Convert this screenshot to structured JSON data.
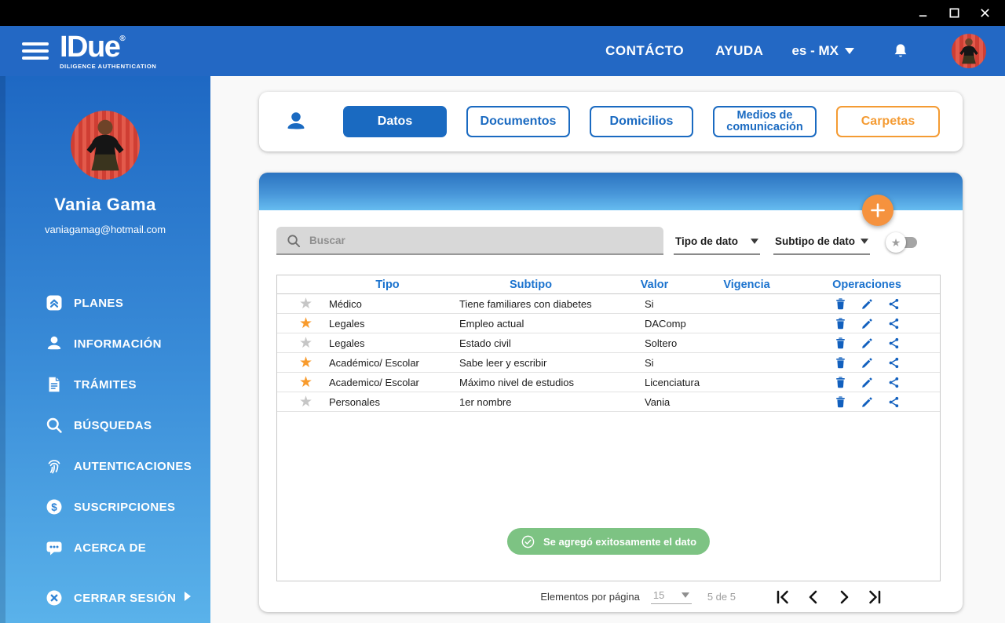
{
  "header": {
    "logo": {
      "title": "IDue",
      "registered": "®",
      "subtitle": "DILIGENCE AUTHENTICATION"
    },
    "nav": {
      "contact": "CONTÁCTO",
      "help": "AYUDA",
      "language": "es - MX"
    },
    "bell_icon": "bell-icon",
    "menu_icon": "hamburger-icon"
  },
  "sidebar": {
    "user": {
      "name": "Vania Gama",
      "email": "vaniagamag@hotmail.com"
    },
    "items": [
      {
        "label": "PLANES",
        "icon": "plans-icon"
      },
      {
        "label": "INFORMACIÓN",
        "icon": "person-icon"
      },
      {
        "label": "TRÁMITES",
        "icon": "document-icon"
      },
      {
        "label": "BÚSQUEDAS",
        "icon": "search-icon"
      },
      {
        "label": "AUTENTICACIONES",
        "icon": "fingerprint-icon"
      },
      {
        "label": "SUSCRIPCIONES",
        "icon": "dollar-icon"
      },
      {
        "label": "ACERCA DE",
        "icon": "chat-icon"
      }
    ],
    "logout": {
      "label": "CERRAR SESIÓN",
      "icon": "logout-icon"
    }
  },
  "tabs": {
    "leading_icon": "person-icon",
    "items": [
      {
        "label": "Datos",
        "active": true,
        "style": "primary"
      },
      {
        "label": "Documentos",
        "active": false,
        "style": "outline-blue"
      },
      {
        "label": "Domicilios",
        "active": false,
        "style": "outline-blue"
      },
      {
        "label": "Medios de comunicación",
        "active": false,
        "style": "outline-blue two-line"
      },
      {
        "label": "Carpetas",
        "active": false,
        "style": "outline-orange"
      }
    ]
  },
  "panel": {
    "add_button_icon": "plus-icon",
    "search": {
      "placeholder": "Buscar",
      "icon": "search-icon"
    },
    "filters": [
      {
        "label": "Tipo de dato"
      },
      {
        "label": "Subtipo de dato"
      }
    ],
    "favorites_toggle": {
      "icon": "star-icon",
      "state": "off"
    },
    "table": {
      "headers": [
        "Tipo",
        "Subtipo",
        "Valor",
        "Vigencia",
        "Operaciones"
      ],
      "row_actions": [
        "delete-icon",
        "edit-icon",
        "share-icon"
      ],
      "rows": [
        {
          "starred": false,
          "tipo": "Médico",
          "subtipo": "Tiene familiares con diabetes",
          "valor": "Si",
          "vigencia": ""
        },
        {
          "starred": true,
          "tipo": "Legales",
          "subtipo": "Empleo actual",
          "valor": "DAComp",
          "vigencia": ""
        },
        {
          "starred": false,
          "tipo": "Legales",
          "subtipo": "Estado civil",
          "valor": "Soltero",
          "vigencia": ""
        },
        {
          "starred": true,
          "tipo": "Académico/ Escolar",
          "subtipo": "Sabe leer y escribir",
          "valor": "Si",
          "vigencia": ""
        },
        {
          "starred": true,
          "tipo": "Academico/ Escolar",
          "subtipo": "Máximo nivel de estudios",
          "valor": "Licenciatura",
          "vigencia": ""
        },
        {
          "starred": false,
          "tipo": "Personales",
          "subtipo": "1er nombre",
          "valor": "Vania",
          "vigencia": ""
        }
      ]
    },
    "toast": {
      "icon": "check-circle-icon",
      "message": "Se agregó exitosamente el dato"
    },
    "pagination": {
      "label": "Elementos por página",
      "page_size": "15",
      "range": "5 de 5",
      "controls": [
        "first-page-icon",
        "prev-page-icon",
        "next-page-icon",
        "last-page-icon"
      ]
    }
  },
  "colors": {
    "titlebar": "#000000",
    "header_blue": "#2368c4",
    "sidebar_top": "#1e68c3",
    "sidebar_bottom": "#5ab2ea",
    "primary_blue": "#1a6ac1",
    "table_header_blue": "#1a72ce",
    "operations_blue": "#1260be",
    "accent_orange": "#f5923e",
    "carpetas_orange": "#f49b33",
    "toast_green": "#7dc383",
    "star_active": "#f89b2d",
    "star_inactive": "#c6c6c6"
  }
}
